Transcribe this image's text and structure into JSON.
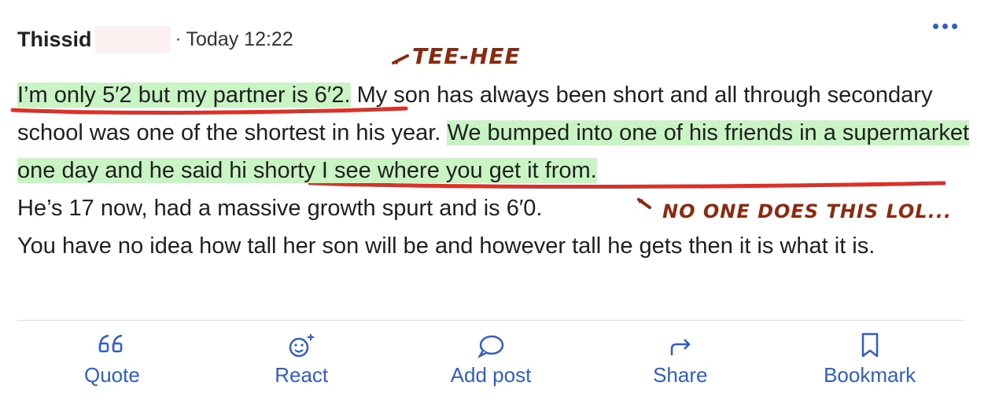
{
  "post": {
    "username": "Thissid",
    "separator": "·",
    "timestamp": "Today 12:22",
    "body": {
      "seg1": "I’m only 5′2 but my partner is 6′2.",
      "seg2": " My son has always been short and all through secondary school was one of the shortest in his year. ",
      "seg3a": "We bumped into one of his friends in a supermarket ",
      "seg3b": "one day and he said hi shorty I see where you get it from.",
      "seg4": "He’s 17 now, had a massive growth spurt and is 6′0.",
      "seg5": "You have no idea how tall her son will be and however tall he gets then it is what it is."
    }
  },
  "annotations": {
    "tee_hee": "TEE-HEE",
    "no_one": "NO ONE DOES THIS LOL..."
  },
  "actions": {
    "quote": "Quote",
    "react": "React",
    "add_post": "Add post",
    "share": "Share",
    "bookmark": "Bookmark"
  },
  "colors": {
    "accent": "#2f5ec4",
    "highlight": "#c9f5c4",
    "underline": "#d9322b",
    "annotation": "#8b2a10"
  },
  "icons": [
    "more-dots-icon",
    "quote-icon",
    "react-icon",
    "speech-bubble-icon",
    "share-arrow-icon",
    "bookmark-icon"
  ]
}
